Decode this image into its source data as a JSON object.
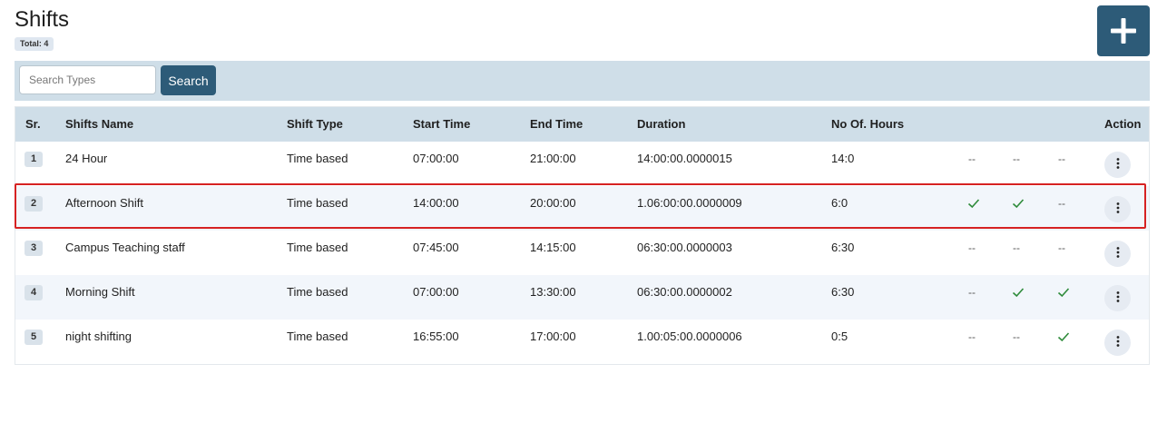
{
  "page": {
    "title": "Shifts",
    "total_label": "Total: 4"
  },
  "toolbar": {
    "add_icon": "plus-icon"
  },
  "search": {
    "placeholder": "Search Types",
    "value": "",
    "button_label": "Search"
  },
  "table": {
    "headers": {
      "sr": "Sr.",
      "name": "Shifts Name",
      "type": "Shift Type",
      "start": "Start Time",
      "end": "End Time",
      "duration": "Duration",
      "hours": "No Of. Hours",
      "action": "Action"
    },
    "dash": "--",
    "check_color": "#2e8b3a",
    "action_icon": "more-vertical-icon",
    "rows": [
      {
        "sr": "1",
        "name": "24 Hour",
        "type": "Time based",
        "start": "07:00:00",
        "end": "21:00:00",
        "duration": "14:00:00.0000015",
        "hours": "14:0",
        "flags": [
          false,
          false,
          false
        ]
      },
      {
        "sr": "2",
        "name": "Afternoon Shift",
        "type": "Time based",
        "start": "14:00:00",
        "end": "20:00:00",
        "duration": "1.06:00:00.0000009",
        "hours": "6:0",
        "flags": [
          true,
          true,
          false
        ],
        "highlighted": true
      },
      {
        "sr": "3",
        "name": "Campus Teaching staff",
        "type": "Time based",
        "start": "07:45:00",
        "end": "14:15:00",
        "duration": "06:30:00.0000003",
        "hours": "6:30",
        "flags": [
          false,
          false,
          false
        ]
      },
      {
        "sr": "4",
        "name": "Morning Shift",
        "type": "Time based",
        "start": "07:00:00",
        "end": "13:30:00",
        "duration": "06:30:00.0000002",
        "hours": "6:30",
        "flags": [
          false,
          true,
          true
        ]
      },
      {
        "sr": "5",
        "name": "night shifting",
        "type": "Time based",
        "start": "16:55:00",
        "end": "17:00:00",
        "duration": "1.00:05:00.0000006",
        "hours": "0:5",
        "flags": [
          false,
          false,
          true
        ]
      }
    ]
  }
}
